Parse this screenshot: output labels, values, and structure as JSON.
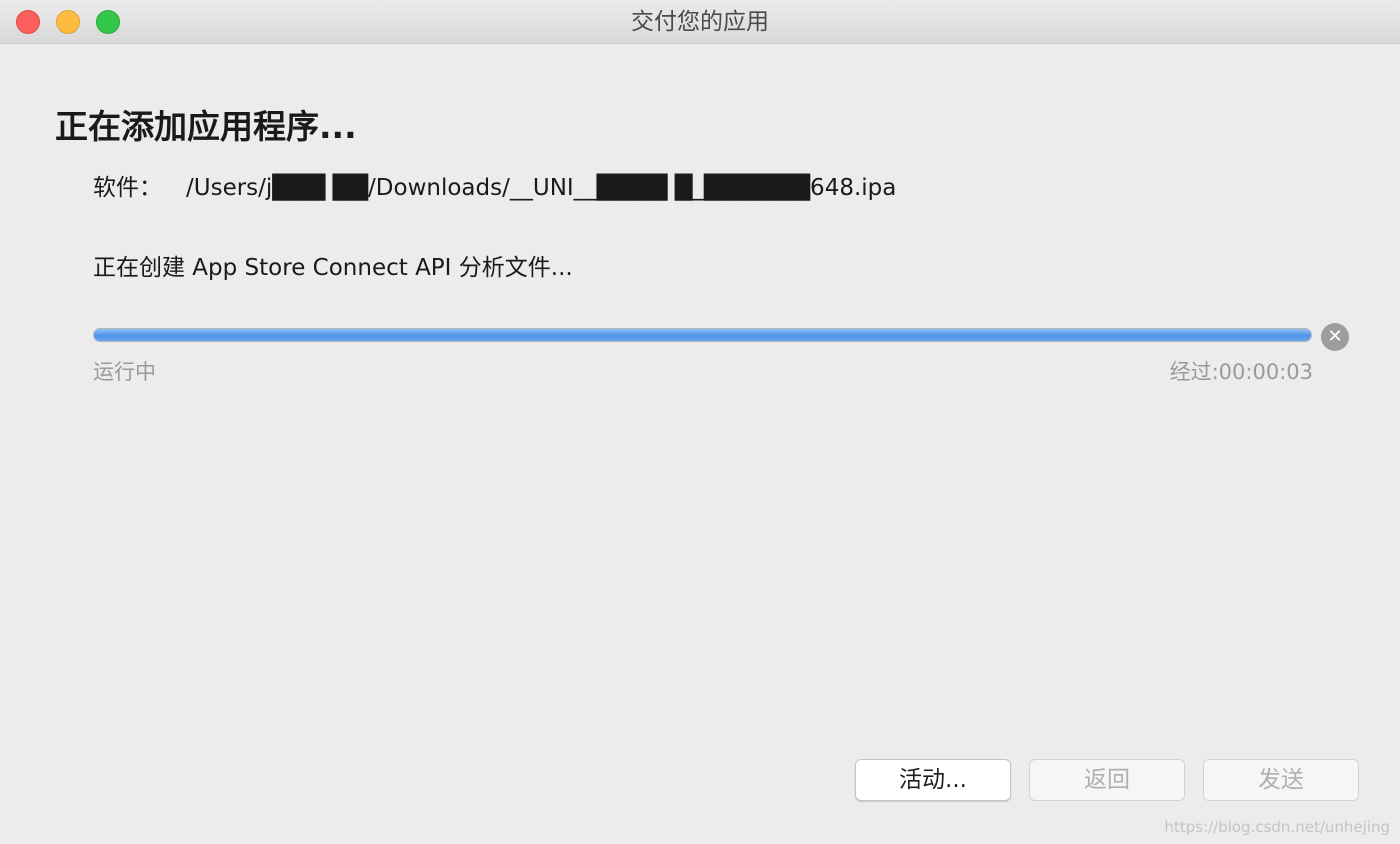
{
  "window": {
    "title": "交付您的应用"
  },
  "main": {
    "heading": "正在添加应用程序...",
    "software_label": "软件：",
    "software_path": "/Users/j███ ██/Downloads/__UNI__████ █_██████648.ipa",
    "status": "正在创建 App Store Connect API 分析文件...",
    "progress": {
      "fraction": 1.0,
      "fill_color": "#4f92e8",
      "state": "运行中",
      "elapsed": "经过:00:00:03"
    }
  },
  "footer": {
    "activity_label": "活动...",
    "back_label": "返回",
    "send_label": "发送"
  },
  "watermark": "https://blog.csdn.net/unhejing"
}
